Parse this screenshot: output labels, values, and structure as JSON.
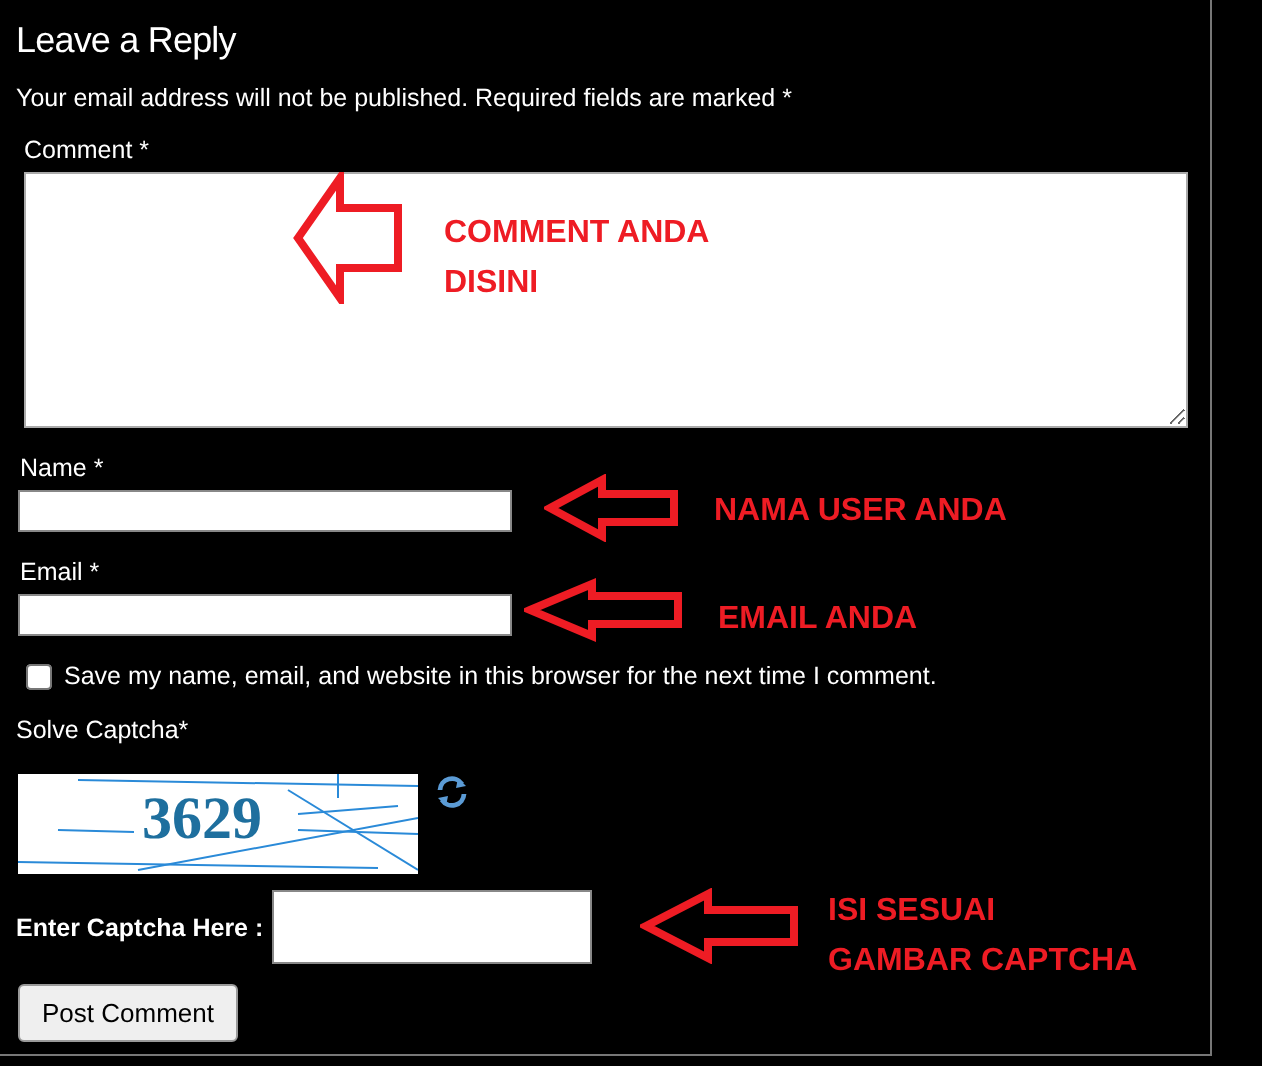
{
  "title": "Leave a Reply",
  "notice": "Your email address will not be published. Required fields are marked *",
  "comment": {
    "label": "Comment *"
  },
  "name": {
    "label": "Name *"
  },
  "email": {
    "label": "Email *"
  },
  "save_info": {
    "label": "Save my name, email, and website in this browser for the next time I comment.",
    "checked": false
  },
  "captcha": {
    "label": "Solve Captcha*",
    "code": "3629",
    "input_label": "Enter Captcha Here :"
  },
  "submit": "Post Comment",
  "annotations": [
    {
      "lines": [
        "COMMENT ANDA",
        "DISINI"
      ]
    },
    {
      "lines": [
        "NAMA USER ANDA"
      ]
    },
    {
      "lines": [
        "EMAIL ANDA"
      ]
    },
    {
      "lines": [
        "ISI SESUAI",
        "GAMBAR CAPTCHA"
      ]
    }
  ]
}
